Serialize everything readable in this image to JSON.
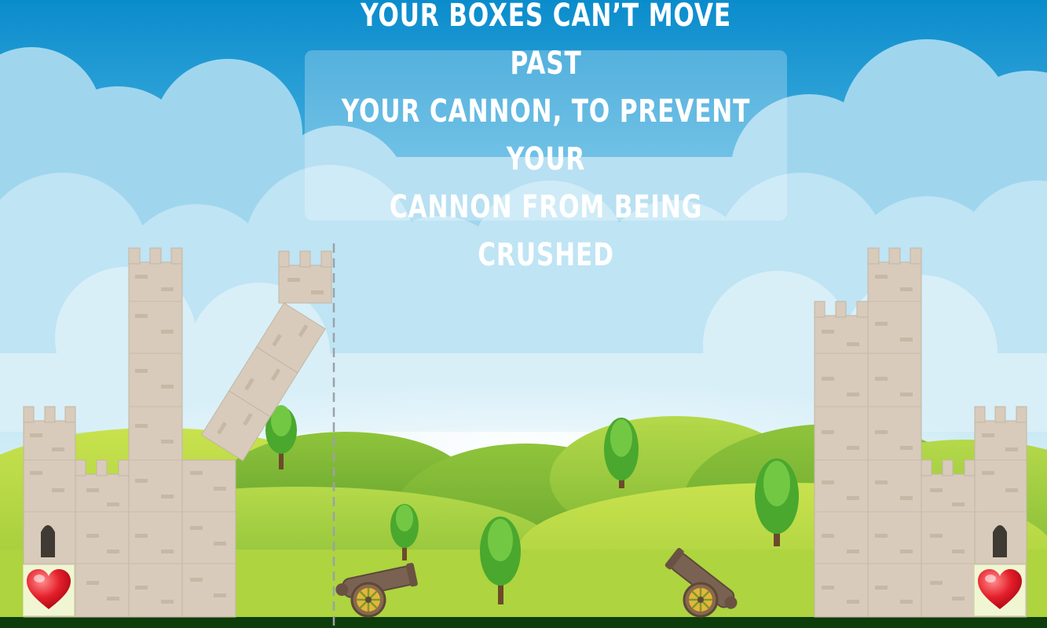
{
  "hint": {
    "text": "YOUR BOXES CAN’T MOVE PAST\nYOUR CANNON, TO PREVENT YOUR\nCANNON FROM BEING CRUSHED"
  },
  "players": {
    "left": {
      "lives_icon": "heart-icon"
    },
    "right": {
      "lives_icon": "heart-icon"
    }
  },
  "colors": {
    "sky_top": "#0a7fc9",
    "cloud": "#a9dcf0",
    "hill_light": "#a6d23c",
    "hill_dark": "#7cbc3a",
    "ground": "#0d3d0a",
    "castle_block": "#d8cbbb",
    "castle_brick": "#c7b8a5",
    "heart": "#e01826"
  }
}
